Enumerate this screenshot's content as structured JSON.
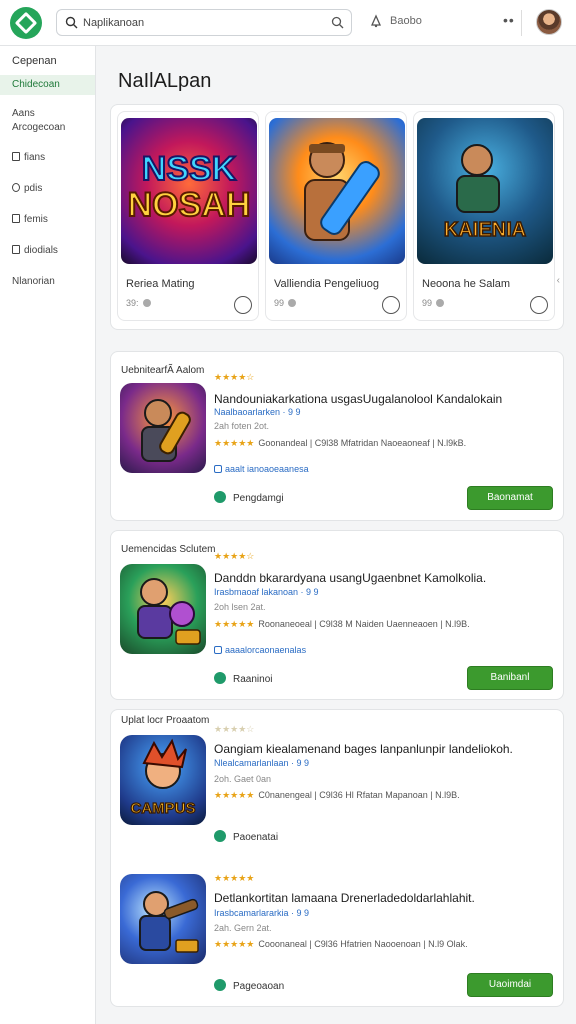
{
  "header": {
    "search_value": "Naplikanoan",
    "nav_label": "Baobo"
  },
  "sidebar": {
    "heading": "Cepenan",
    "active": "Chidecoan",
    "items": [
      {
        "label": "Aans",
        "icon": "none"
      },
      {
        "label": "Arcogecoan",
        "icon": "none"
      },
      {
        "label": "fians",
        "icon": "square-icon"
      },
      {
        "label": "pdis",
        "icon": "circle-icon"
      },
      {
        "label": "femis",
        "icon": "square-icon"
      },
      {
        "label": "diodials",
        "icon": "square-icon"
      },
      {
        "label": "Nlanorian",
        "icon": "none"
      }
    ]
  },
  "page": {
    "title": "NaIlALpan"
  },
  "featured": [
    {
      "name": "Reriea Mating",
      "meta": "39:",
      "art_text": "NSSK NOSAH"
    },
    {
      "name": "Valliendia Pengeliuog",
      "meta": "99"
    },
    {
      "name": "Neoona he Salam",
      "meta": "99",
      "art_text": "KAIENIA"
    }
  ],
  "list": [
    {
      "header": "UebnitearfÃ Aalom",
      "title": "Nandouniakarkationa usgasUugalanolool Kandalokain",
      "subtitle": "Naalbaoarlarken · 9 9",
      "subline": "2ah  foten  2ot.",
      "rating": "Goonandeal | C9l38 Mfatridan  Naoeaoneaf | N.l9kB.",
      "link": "aaalt ianoaoeaanesa",
      "status": "Pengdamgi",
      "button": "Baonamat"
    },
    {
      "header": "Uemencidas Sclutem",
      "title": "Danddn bkarardyana usangUgaenbnet Kamolkolia.",
      "subtitle": "Irasbmaoaf lakanoan · 9 9",
      "subline": "2oh  lsen  2at.",
      "rating": "Roonaneoeal | C9l38 M Naiden  Uaenneaoen | N.l9B.",
      "link": "aaaalorcaonaenalas",
      "status": "Raaninoi",
      "button": "Banibanl"
    },
    {
      "header": "Uplat  locr Proaatom",
      "title": "Oangiam kiealamenand bages lanpanlunpir landeliokoh.",
      "subtitle": "Nlealcamarlanlaan · 9 9",
      "subline": "2oh. Gaet  0an",
      "rating": "C0nanengeal | C9l36 Hl Rfatan  Mapanoan | N.l9B.",
      "status": "Paoenatai",
      "art_text": "CAMPUS"
    },
    {
      "header": "",
      "title": "Detlankortitan lamaana Drenerladedoldarlahlahit.",
      "subtitle": "Irasbcamarlararkia · 9 9",
      "subline": "2ah. Gern  2at.",
      "rating": "Cooonaneal | C9l36 Hfatrien  Naooenoan | N.l9 Olak.",
      "status": "Pageoaoan",
      "button": "Uaoimdai"
    }
  ]
}
